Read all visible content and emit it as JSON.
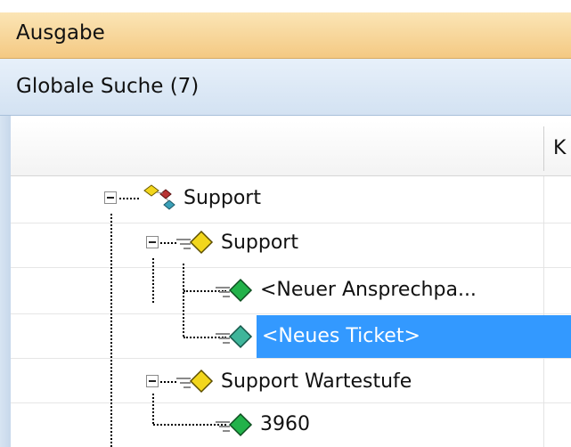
{
  "panels": {
    "output_title": "Ausgabe",
    "search_title": "Globale Suche (7)"
  },
  "table": {
    "columns": [
      "",
      "K"
    ]
  },
  "tree": {
    "nodes": [
      {
        "label": "Support",
        "icon": "project-icon"
      },
      {
        "label": "Support",
        "icon": "folder-diamond-icon"
      },
      {
        "label": "<Neuer Ansprechpa...",
        "icon": "green-diamond-icon"
      },
      {
        "label": "<Neues Ticket>",
        "icon": "teal-diamond-icon",
        "selected": true
      },
      {
        "label": "Support Wartestufe",
        "icon": "folder-diamond-icon"
      },
      {
        "label": "3960",
        "icon": "green-diamond-icon"
      }
    ]
  },
  "colors": {
    "output_bar": "#f4c983",
    "search_bar": "#d3e2f2",
    "selection": "#3399ff"
  }
}
